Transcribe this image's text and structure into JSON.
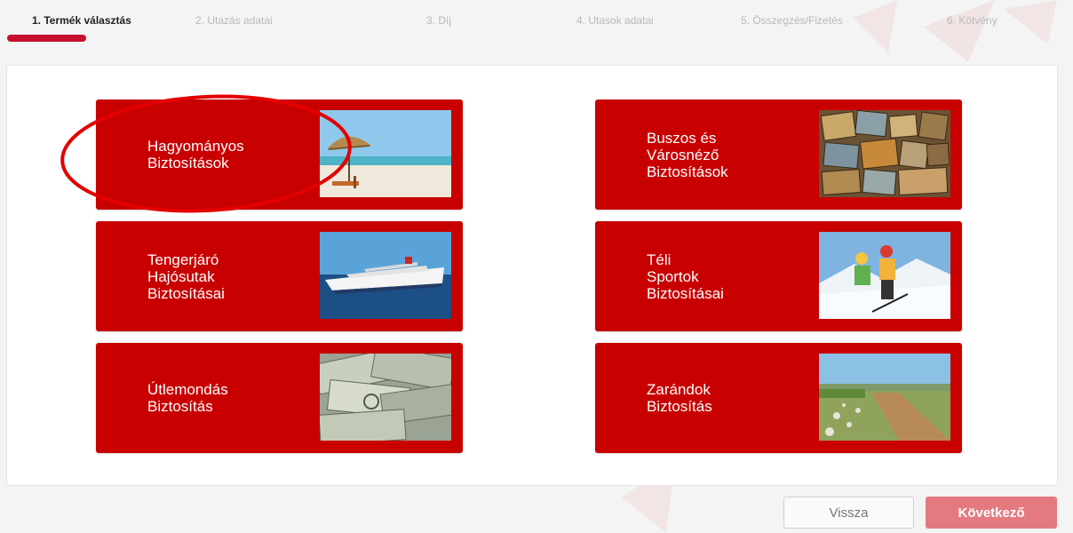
{
  "steps": [
    {
      "label": "1. Termék választás",
      "active": true
    },
    {
      "label": "2. Utazás adatai",
      "active": false
    },
    {
      "label": "3. Díj",
      "active": false
    },
    {
      "label": "4. Utasok adatai",
      "active": false
    },
    {
      "label": "5. Összegzés/Fizetés",
      "active": false
    },
    {
      "label": "6. Kötvény",
      "active": false
    }
  ],
  "products": [
    {
      "lines": [
        "Hagyományos",
        "Biztosítások"
      ],
      "image": "beach-umbrella-image"
    },
    {
      "lines": [
        "Buszos és",
        "Városnéző",
        "Biztosítások"
      ],
      "image": "city-postcards-image"
    },
    {
      "lines": [
        "Tengerjáró",
        "Hajósutak",
        "Biztosításai"
      ],
      "image": "cruise-ship-image"
    },
    {
      "lines": [
        "Téli",
        "Sportok",
        "Biztosításai"
      ],
      "image": "skiers-image"
    },
    {
      "lines": [
        "Útlemondás",
        "Biztosítás"
      ],
      "image": "dollar-bills-image"
    },
    {
      "lines": [
        "Zarándok",
        "Biztosítás"
      ],
      "image": "pilgrim-path-image"
    }
  ],
  "buttons": {
    "back": "Vissza",
    "next": "Következő"
  },
  "colors": {
    "accent": "#c80000",
    "step_bar": "#c8102e",
    "next_button": "#e47a80",
    "highlight_circle": "#e30000"
  }
}
